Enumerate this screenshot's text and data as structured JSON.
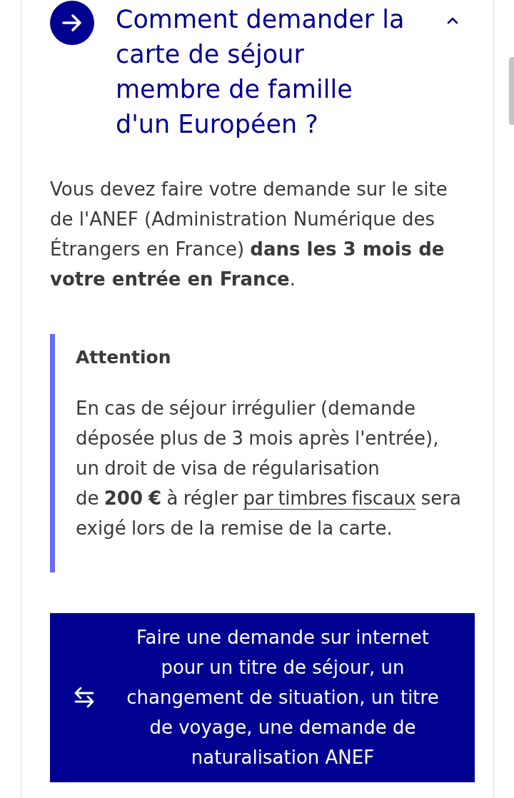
{
  "accordion": {
    "title": "Comment demander la carte de séjour membre de famille d'un Européen ?",
    "expanded": true
  },
  "intro": "Vous devez faire votre demande sur le site de l'ANEF (Administration Numérique des Étrangers en France) **dans les 3 mois de votre entrée en France**.",
  "callout": {
    "title": "Attention",
    "body": [
      {
        "kind": "text",
        "text": "En cas de séjour irrégulier (demande déposée plus de 3 mois après l'entrée), un droit de visa de régularisation de **200 €** à régler"
      },
      {
        "kind": "link",
        "text": "par timbres fiscaux"
      },
      {
        "kind": "text",
        "text": "sera exigé lors de la remise de la carte."
      }
    ]
  },
  "action_button": {
    "label": "Faire une demande sur internet pour un titre de séjour, un changement de situation, un titre de voyage, une demande de naturalisation ANEF"
  }
}
